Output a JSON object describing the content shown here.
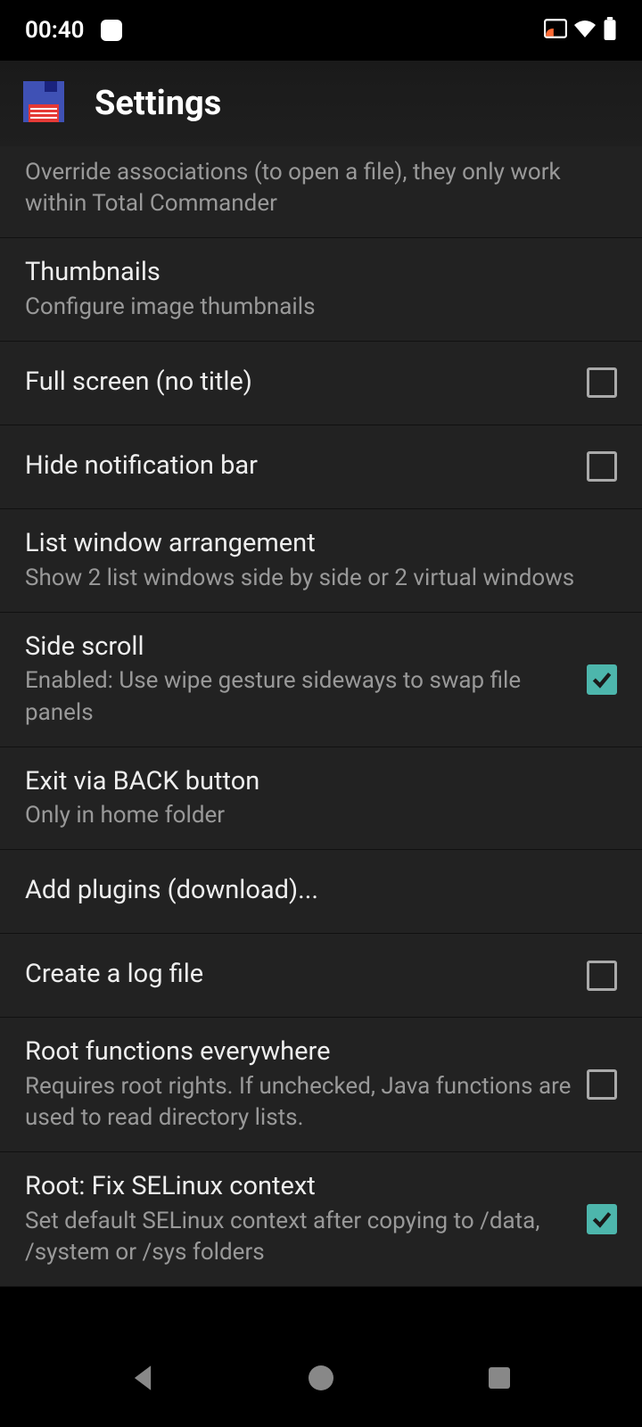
{
  "statusBar": {
    "time": "00:40"
  },
  "header": {
    "title": "Settings"
  },
  "items": [
    {
      "subtitle": "Override associations (to open a file), they only work within Total Commander"
    },
    {
      "title": "Thumbnails",
      "subtitle": "Configure image thumbnails"
    },
    {
      "title": "Full screen (no title)"
    },
    {
      "title": "Hide notification bar"
    },
    {
      "title": "List window arrangement",
      "subtitle": "Show 2 list windows side by side or 2 virtual windows"
    },
    {
      "title": "Side scroll",
      "subtitle": "Enabled: Use wipe gesture sideways to swap file panels"
    },
    {
      "title": "Exit via BACK button",
      "subtitle": "Only in home folder"
    },
    {
      "title": "Add plugins (download)..."
    },
    {
      "title": "Create a log file"
    },
    {
      "title": "Root functions everywhere",
      "subtitle": "Requires root rights. If unchecked, Java functions are used to read directory lists."
    },
    {
      "title": "Root: Fix SELinux context",
      "subtitle": "Set default SELinux context after copying to /data, /system or /sys folders"
    }
  ]
}
